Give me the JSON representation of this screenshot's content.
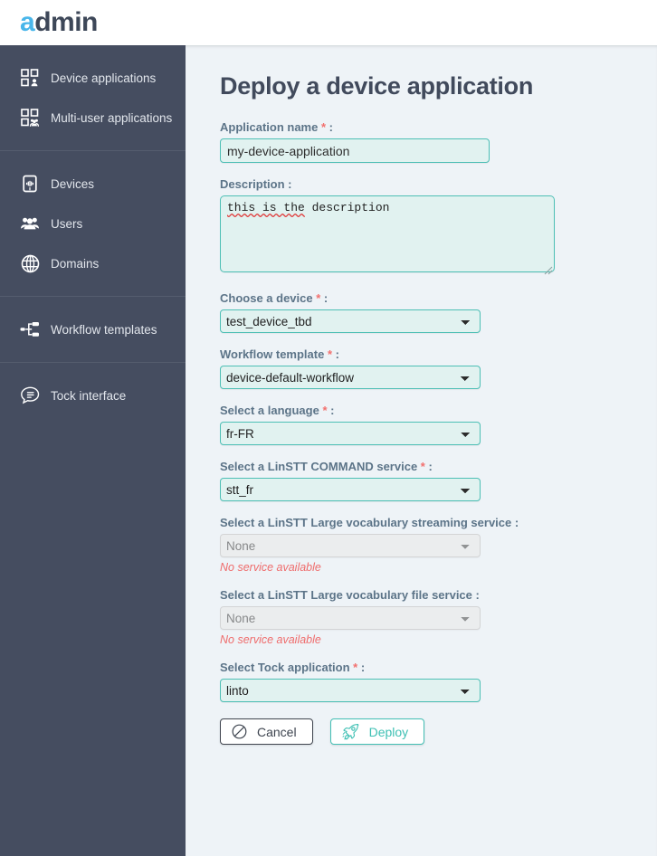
{
  "brand": {
    "name_accent": "a",
    "name_rest": "dmin"
  },
  "sidebar": {
    "groups": [
      {
        "items": [
          {
            "label": "Device applications",
            "icon": "device-applications-icon"
          },
          {
            "label": "Multi-user applications",
            "icon": "multi-user-applications-icon"
          }
        ]
      },
      {
        "items": [
          {
            "label": "Devices",
            "icon": "devices-icon"
          },
          {
            "label": "Users",
            "icon": "users-icon"
          },
          {
            "label": "Domains",
            "icon": "domains-icon"
          }
        ]
      },
      {
        "items": [
          {
            "label": "Workflow templates",
            "icon": "workflow-templates-icon"
          }
        ]
      },
      {
        "items": [
          {
            "label": "Tock interface",
            "icon": "tock-interface-icon"
          }
        ]
      }
    ]
  },
  "page": {
    "title": "Deploy a device application",
    "fields": {
      "application_name": {
        "label": "Application name",
        "required_mark": "*",
        "colon": ":",
        "value": "my-device-application",
        "placeholder": ""
      },
      "description": {
        "label": "Description",
        "required_mark": "",
        "colon": ":",
        "value": "this is the description",
        "misspelled": "this is the",
        "rest": " description",
        "placeholder": ""
      },
      "device": {
        "label": "Choose a device",
        "required_mark": "*",
        "colon": ":",
        "value": "test_device_tbd"
      },
      "workflow_template": {
        "label": "Workflow template",
        "required_mark": "*",
        "colon": ":",
        "value": "device-default-workflow"
      },
      "language": {
        "label": "Select a language",
        "required_mark": "*",
        "colon": ":",
        "value": "fr-FR"
      },
      "linstt_command": {
        "label": "Select a LinSTT COMMAND service",
        "required_mark": "*",
        "colon": ":",
        "value": "stt_fr"
      },
      "linstt_streaming": {
        "label": "Select a LinSTT Large vocabulary streaming service",
        "required_mark": "",
        "colon": ":",
        "value": "None",
        "error": "No service available"
      },
      "linstt_file": {
        "label": "Select a LinSTT Large vocabulary file service",
        "required_mark": "",
        "colon": ":",
        "value": "None",
        "error": "No service available"
      },
      "tock_application": {
        "label": "Select Tock application",
        "required_mark": "*",
        "colon": ":",
        "value": "linto"
      }
    },
    "buttons": {
      "cancel": {
        "label": "Cancel",
        "icon": "ban-icon"
      },
      "deploy": {
        "label": "Deploy",
        "icon": "rocket-icon"
      }
    }
  },
  "colors": {
    "sidebar_bg": "#454d60",
    "accent_teal": "#43bfb4",
    "brand_blue": "#49b6ea",
    "label_slate": "#5c7488",
    "error_red": "#ef6c6c",
    "page_bg": "#eef3f7"
  }
}
